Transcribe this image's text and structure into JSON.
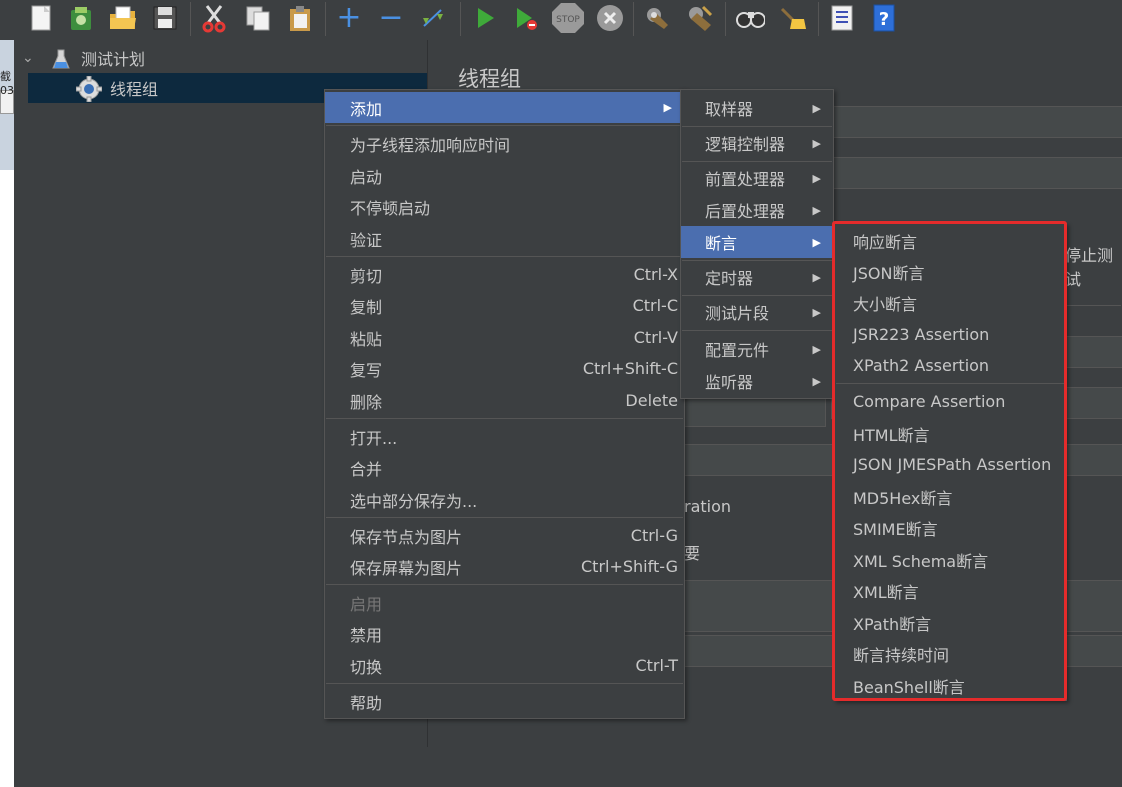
{
  "toolbar": {
    "icons": [
      "new-icon",
      "templates-icon",
      "open-icon",
      "save-icon",
      "cut-icon",
      "copy-icon",
      "paste-icon",
      "expand-icon",
      "collapse-icon",
      "toggle-icon",
      "start-icon",
      "start-no-pause-icon",
      "stop-icon",
      "shutdown-icon",
      "clear-icon",
      "clear-all-icon",
      "search-icon",
      "reset-search-icon",
      "function-helper-icon",
      "help-icon"
    ]
  },
  "left_strip": {
    "label1": "截",
    "label2": "03"
  },
  "tree": {
    "items": [
      {
        "label": "测试计划"
      },
      {
        "label": "线程组"
      }
    ]
  },
  "right_panel": {
    "title": "线程组",
    "frag_stop": "停止测试",
    "frag_ration": "ration",
    "frag_small": "要"
  },
  "context_menu": {
    "items": [
      {
        "label": "添加",
        "shortcut": "",
        "arrow": "▶"
      },
      {
        "label": "为子线程添加响应时间",
        "shortcut": ""
      },
      {
        "label": "启动",
        "shortcut": ""
      },
      {
        "label": "不停顿启动",
        "shortcut": ""
      },
      {
        "label": "验证",
        "shortcut": ""
      },
      {
        "label": "剪切",
        "shortcut": "Ctrl-X"
      },
      {
        "label": "复制",
        "shortcut": "Ctrl-C"
      },
      {
        "label": "粘贴",
        "shortcut": "Ctrl-V"
      },
      {
        "label": "复写",
        "shortcut": "Ctrl+Shift-C"
      },
      {
        "label": "删除",
        "shortcut": "Delete"
      },
      {
        "label": "打开...",
        "shortcut": ""
      },
      {
        "label": "合并",
        "shortcut": ""
      },
      {
        "label": "选中部分保存为...",
        "shortcut": ""
      },
      {
        "label": "保存节点为图片",
        "shortcut": "Ctrl-G"
      },
      {
        "label": "保存屏幕为图片",
        "shortcut": "Ctrl+Shift-G"
      },
      {
        "label": "启用",
        "shortcut": ""
      },
      {
        "label": "禁用",
        "shortcut": ""
      },
      {
        "label": "切换",
        "shortcut": "Ctrl-T"
      },
      {
        "label": "帮助",
        "shortcut": ""
      }
    ]
  },
  "add_submenu": {
    "items": [
      {
        "label": "取样器",
        "arrow": "▶"
      },
      {
        "label": "逻辑控制器",
        "arrow": "▶"
      },
      {
        "label": "前置处理器",
        "arrow": "▶"
      },
      {
        "label": "后置处理器",
        "arrow": "▶"
      },
      {
        "label": "断言",
        "arrow": "▶"
      },
      {
        "label": "定时器",
        "arrow": "▶"
      },
      {
        "label": "测试片段",
        "arrow": "▶"
      },
      {
        "label": "配置元件",
        "arrow": "▶"
      },
      {
        "label": "监听器",
        "arrow": "▶"
      }
    ]
  },
  "assertion_submenu": {
    "items": [
      {
        "label": "响应断言"
      },
      {
        "label": "JSON断言"
      },
      {
        "label": "大小断言"
      },
      {
        "label": "JSR223 Assertion"
      },
      {
        "label": "XPath2 Assertion"
      },
      {
        "label": "Compare Assertion"
      },
      {
        "label": "HTML断言"
      },
      {
        "label": "JSON JMESPath Assertion"
      },
      {
        "label": "MD5Hex断言"
      },
      {
        "label": "SMIME断言"
      },
      {
        "label": "XML Schema断言"
      },
      {
        "label": "XML断言"
      },
      {
        "label": "XPath断言"
      },
      {
        "label": "断言持续时间"
      },
      {
        "label": "BeanShell断言"
      }
    ]
  },
  "colors": {
    "background": "#3c3f41",
    "highlight": "#4b6eaf",
    "tree_selection": "#0d293e",
    "annotation_box": "#e52b2b"
  }
}
